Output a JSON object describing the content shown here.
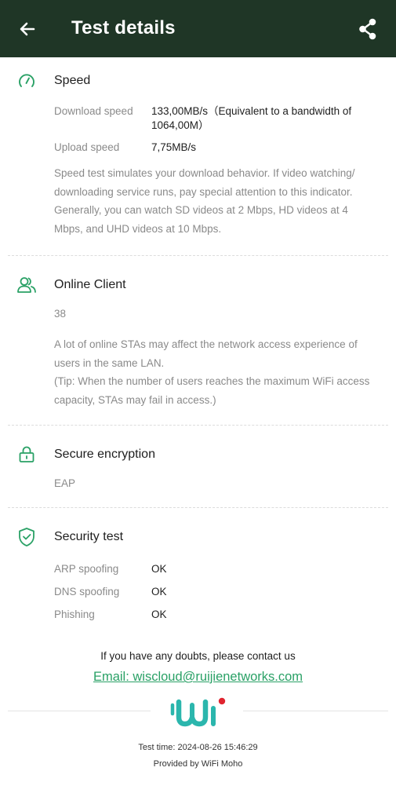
{
  "header": {
    "title": "Test details"
  },
  "speed": {
    "title": "Speed",
    "download_label": "Download speed",
    "download_value": "133,00MB/s（Equivalent to a bandwidth of 1064,00M）",
    "upload_label": "Upload speed",
    "upload_value": "7,75MB/s",
    "description": "Speed test simulates your download behavior. If video watching/ downloading service runs, pay special attention to this indicator. Generally, you can watch SD videos at 2 Mbps, HD videos at 4 Mbps, and UHD videos at 10 Mbps."
  },
  "online_client": {
    "title": "Online Client",
    "count": "38",
    "description": "A lot of online STAs may affect the network access experience of users in the same LAN.",
    "tip": "(Tip: When the number of users reaches the maximum WiFi access capacity, STAs may fail in access.)"
  },
  "encryption": {
    "title": "Secure encryption",
    "value": "EAP"
  },
  "security": {
    "title": "Security test",
    "items": [
      {
        "label": "ARP spoofing",
        "value": "OK"
      },
      {
        "label": "DNS spoofing",
        "value": "OK"
      },
      {
        "label": "Phishing",
        "value": "OK"
      }
    ]
  },
  "contact": {
    "text": "If you have any doubts, please contact us",
    "email": "Email: wiscloud@ruijienetworks.com"
  },
  "footer": {
    "test_time": "Test time: 2024-08-26 15:46:29",
    "provided_by": "Provided by WiFi Moho",
    "logo_text": "Wi"
  },
  "icons": {
    "back": "arrow-left-icon",
    "share": "share-icon",
    "speed": "speedometer-icon",
    "online_client": "users-icon",
    "encryption": "lock-icon",
    "security": "shield-check-icon"
  },
  "colors": {
    "header_bg": "#1f3626",
    "accent": "#2aa166",
    "logo_teal": "#2bb6ad",
    "logo_red": "#e0242f"
  }
}
